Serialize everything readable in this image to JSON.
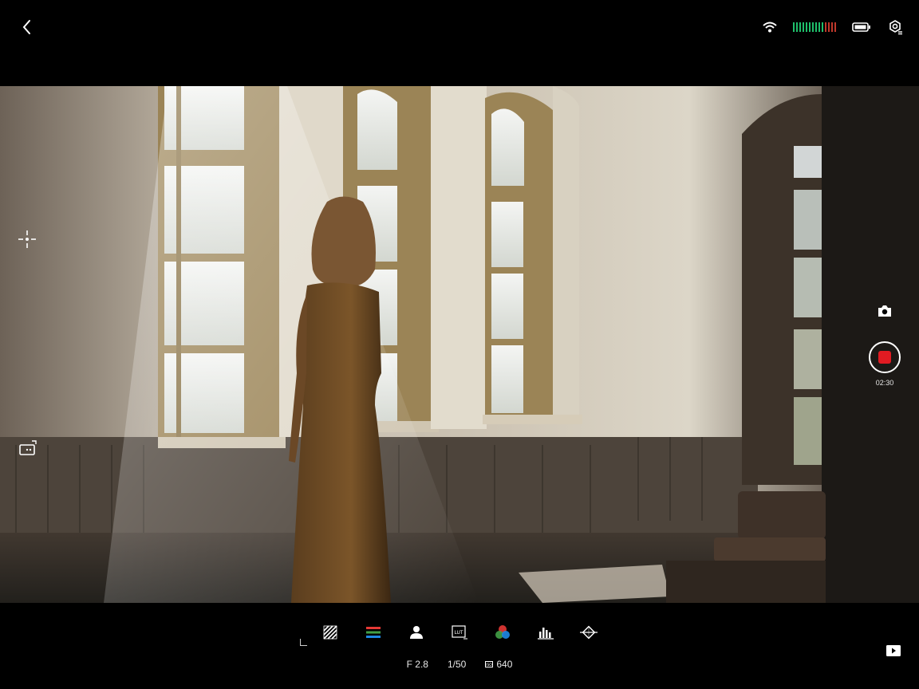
{
  "header": {
    "icons": [
      "back-chevron-icon",
      "wifi-icon",
      "signal-meter-icon",
      "battery-icon",
      "camera-settings-icon"
    ]
  },
  "left_tools": {
    "icons": [
      "focus-crosshair-icon",
      "aspect-switch-icon"
    ]
  },
  "record": {
    "time": "02:30",
    "color": "#e11b22",
    "icons": [
      "camera-icon",
      "record-icon"
    ]
  },
  "bottom_tools": {
    "icons": [
      "zebra-icon",
      "rgb-parade-icon",
      "person-icon",
      "lut-icon",
      "color-wheel-icon",
      "histogram-icon",
      "focus-peaking-icon",
      "play-icon"
    ]
  },
  "params": {
    "aperture": "F 2.8",
    "shutter": "1/50",
    "iso": "640"
  },
  "colors": {
    "signal_active": "#1fbf6b",
    "signal_inactive": "#c0392b"
  }
}
